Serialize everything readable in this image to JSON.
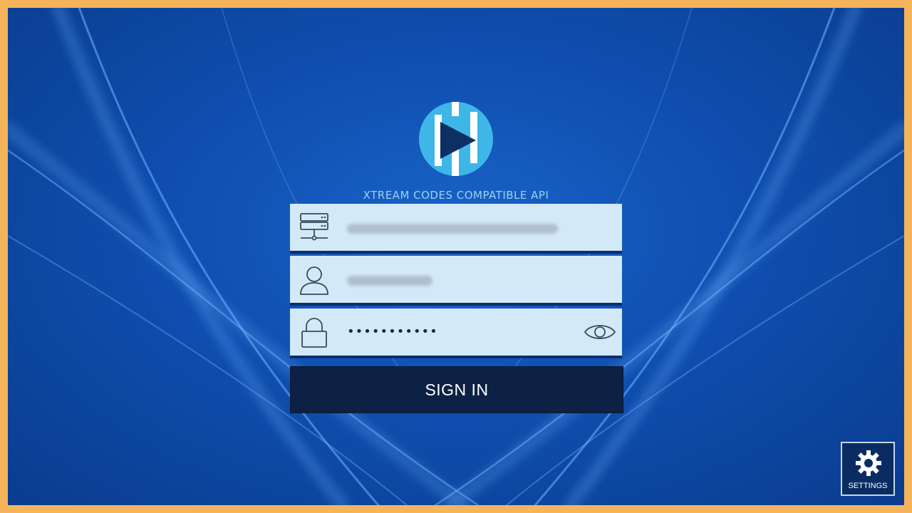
{
  "app": {
    "api_title": "XTREAM CODES COMPATIBLE API"
  },
  "form": {
    "server_field": {
      "value": "",
      "icon": "server-icon",
      "redacted": true
    },
    "username_field": {
      "value": "",
      "icon": "user-icon",
      "redacted": true
    },
    "password_field": {
      "value": "•••••••••••",
      "icon": "lock-icon",
      "toggle_icon": "eye-icon"
    },
    "sign_in_label": "SIGN IN"
  },
  "settings": {
    "label": "SETTINGS",
    "icon": "gear-icon"
  },
  "colors": {
    "background": "#0f4fb0",
    "field": "#d3e9f8",
    "button": "#0c2144",
    "logo": "#3fb6e8",
    "frame": "#f6b45a"
  }
}
